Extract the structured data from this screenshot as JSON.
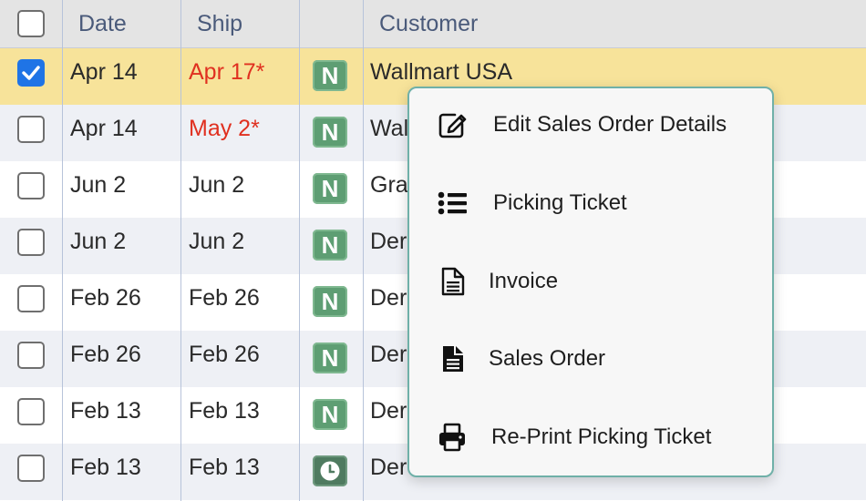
{
  "columns": {
    "date": "Date",
    "ship": "Ship",
    "customer": "Customer"
  },
  "rows": [
    {
      "selected": true,
      "date": "Apr 14",
      "ship": "Apr 17*",
      "ship_overdue": true,
      "status_icon": "n-badge",
      "status_text": "N",
      "customer": "Wallmart USA"
    },
    {
      "selected": false,
      "date": "Apr 14",
      "ship": "May 2*",
      "ship_overdue": true,
      "status_icon": "n-badge",
      "status_text": "N",
      "customer": "Wal"
    },
    {
      "selected": false,
      "date": "Jun 2",
      "ship": "Jun 2",
      "ship_overdue": false,
      "status_icon": "n-badge",
      "status_text": "N",
      "customer": "Gra"
    },
    {
      "selected": false,
      "date": "Jun 2",
      "ship": "Jun 2",
      "ship_overdue": false,
      "status_icon": "n-badge",
      "status_text": "N",
      "customer": "Der"
    },
    {
      "selected": false,
      "date": "Feb 26",
      "ship": "Feb 26",
      "ship_overdue": false,
      "status_icon": "n-badge",
      "status_text": "N",
      "customer": "Der"
    },
    {
      "selected": false,
      "date": "Feb 26",
      "ship": "Feb 26",
      "ship_overdue": false,
      "status_icon": "n-badge",
      "status_text": "N",
      "customer": "Der"
    },
    {
      "selected": false,
      "date": "Feb 13",
      "ship": "Feb 13",
      "ship_overdue": false,
      "status_icon": "n-badge",
      "status_text": "N",
      "customer": "Der"
    },
    {
      "selected": false,
      "date": "Feb 13",
      "ship": "Feb 13",
      "ship_overdue": false,
      "status_icon": "clock-badge",
      "status_text": "",
      "customer": "Der"
    }
  ],
  "context_menu": {
    "items": [
      {
        "label": "Edit Sales Order Details",
        "icon": "edit-icon"
      },
      {
        "label": "Picking Ticket",
        "icon": "list-icon"
      },
      {
        "label": "Invoice",
        "icon": "document-outline-icon"
      },
      {
        "label": "Sales Order",
        "icon": "document-filled-icon"
      },
      {
        "label": "Re-Print Picking Ticket",
        "icon": "printer-icon"
      }
    ]
  },
  "colors": {
    "selected_row": "#f7e39a",
    "alt_row": "#eef0f5",
    "header_bg": "#e4e4e4",
    "overdue_text": "#e03020",
    "checkbox_checked": "#1f74e6",
    "status_badge": "#5e9e73",
    "menu_border": "#6fb0a8"
  }
}
